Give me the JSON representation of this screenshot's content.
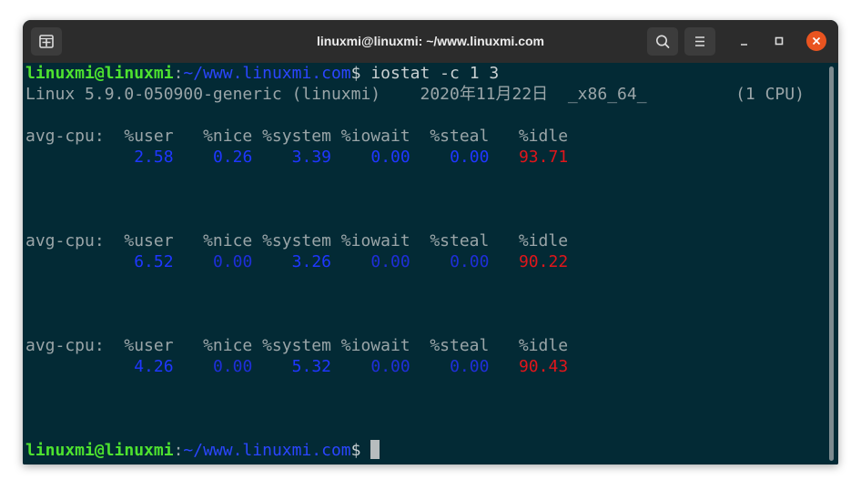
{
  "window": {
    "title": "linuxmi@linuxmi: ~/www.linuxmi.com"
  },
  "icons": {
    "new_tab": "new-tab-icon",
    "search": "search-icon",
    "menu": "hamburger-menu-icon",
    "minimize": "minimize-icon",
    "maximize": "maximize-icon",
    "close": "close-icon"
  },
  "colors": {
    "terminal_bg": "#032a35",
    "titlebar_bg": "#2c2c2c",
    "prompt_user": "#4ee22f",
    "prompt_path": "#2b46ff",
    "value_blue": "#1f37ff",
    "value_red": "#e0161b",
    "close_button": "#e95420"
  },
  "prompt": {
    "user_host": "linuxmi@linuxmi",
    "separator": ":",
    "path": "~/www.linuxmi.com",
    "symbol": "$ "
  },
  "command": "iostat -c 1 3",
  "system_line": "Linux 5.9.0-050900-generic (linuxmi)    2020年11月22日  _x86_64_         (1 CPU)",
  "reports": [
    {
      "header": "avg-cpu:  %user   %nice %system %iowait  %steal   %idle",
      "user": "2.58",
      "nice": "0.26",
      "system": "3.39",
      "iowait": "0.00",
      "steal": "0.00",
      "idle": "93.71"
    },
    {
      "header": "avg-cpu:  %user   %nice %system %iowait  %steal   %idle",
      "user": "6.52",
      "nice": "0.00",
      "system": "3.26",
      "iowait": "0.00",
      "steal": "0.00",
      "idle": "90.22"
    },
    {
      "header": "avg-cpu:  %user   %nice %system %iowait  %steal   %idle",
      "user": "4.26",
      "nice": "0.00",
      "system": "5.32",
      "iowait": "0.00",
      "steal": "0.00",
      "idle": "90.43"
    }
  ]
}
